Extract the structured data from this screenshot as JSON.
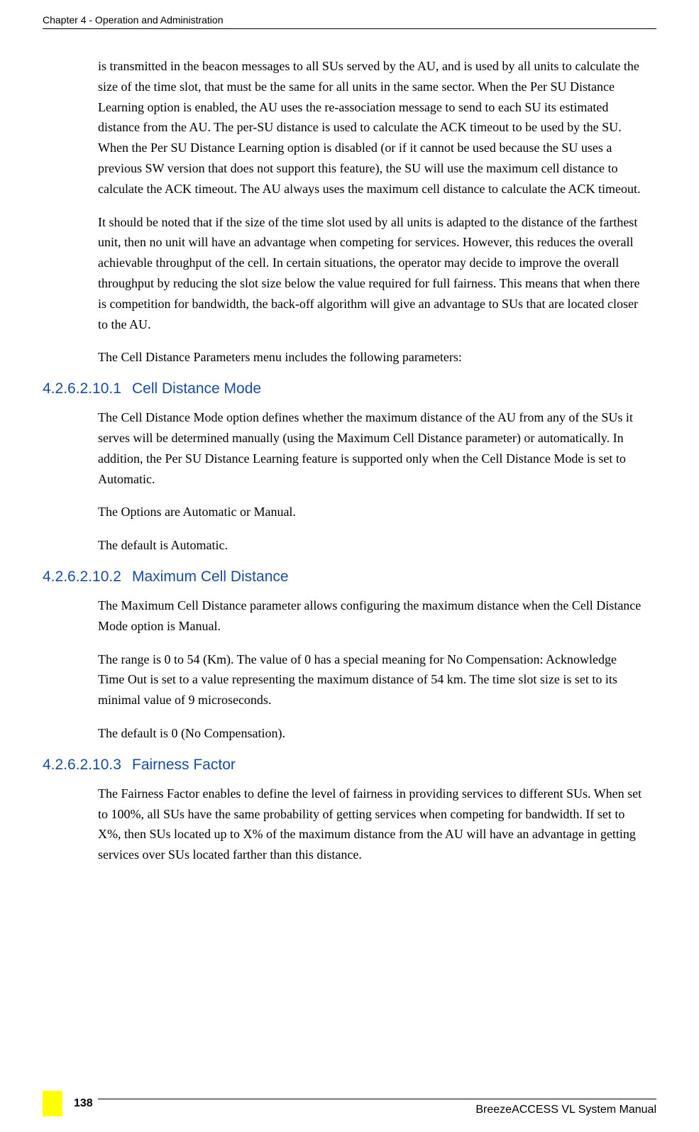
{
  "header": {
    "chapter": "Chapter 4 - Operation and Administration"
  },
  "paragraphs": {
    "p1": "is transmitted in the beacon messages to all SUs served by the AU, and is used by all units to calculate the size of the time slot, that must be the same for all units in the same sector. When the Per SU Distance Learning option is enabled, the AU uses the re-association message to send to each SU its estimated distance from the AU. The per-SU distance is used to calculate the ACK timeout to be used by the SU. When the Per SU Distance Learning option is disabled (or if it cannot be used because the SU uses a previous SW version that does not support this feature), the SU will use the maximum cell distance to calculate the ACK timeout. The AU always uses the maximum cell distance to calculate the ACK timeout.",
    "p2": "It should be noted that if the size of the time slot used by all units is adapted to the distance of the farthest unit, then no unit will have an advantage when competing for services. However, this reduces the overall achievable throughput of the cell. In certain situations, the operator may decide to improve the overall throughput by reducing the slot size below the value required for full fairness. This means that when there is competition for bandwidth, the back-off algorithm will give an advantage to SUs that are located closer to the AU.",
    "p3": "The Cell Distance Parameters menu includes the following parameters:",
    "s1_p1": "The Cell Distance Mode option defines whether the maximum distance of the AU from any of the SUs it serves will be determined manually (using the Maximum Cell Distance parameter) or automatically. In addition, the Per SU Distance Learning feature is supported only when the Cell Distance Mode is set to Automatic.",
    "s1_p2": "The Options are Automatic or Manual.",
    "s1_p3": "The default is Automatic.",
    "s2_p1": "The Maximum Cell Distance parameter allows configuring the maximum distance when the Cell Distance Mode option is Manual.",
    "s2_p2": "The range is 0 to 54 (Km). The value of 0 has a special meaning for No Compensation: Acknowledge Time Out is set to a value representing the maximum distance of 54 km. The time slot size is set to its minimal value of 9 microseconds.",
    "s2_p3": "The default is 0 (No Compensation).",
    "s3_p1": "The Fairness Factor enables to define the level of fairness in providing services to different SUs. When set to 100%, all SUs have the same probability of getting services when competing for bandwidth. If set to X%, then SUs located up to X% of the maximum distance from the AU will have an advantage in getting services over SUs located farther than this distance."
  },
  "sections": {
    "s1": {
      "number": "4.2.6.2.10.1",
      "title": "Cell Distance Mode"
    },
    "s2": {
      "number": "4.2.6.2.10.2",
      "title": "Maximum Cell Distance"
    },
    "s3": {
      "number": "4.2.6.2.10.3",
      "title": "Fairness Factor"
    }
  },
  "footer": {
    "manual": "BreezeACCESS VL System Manual",
    "page": "138"
  }
}
